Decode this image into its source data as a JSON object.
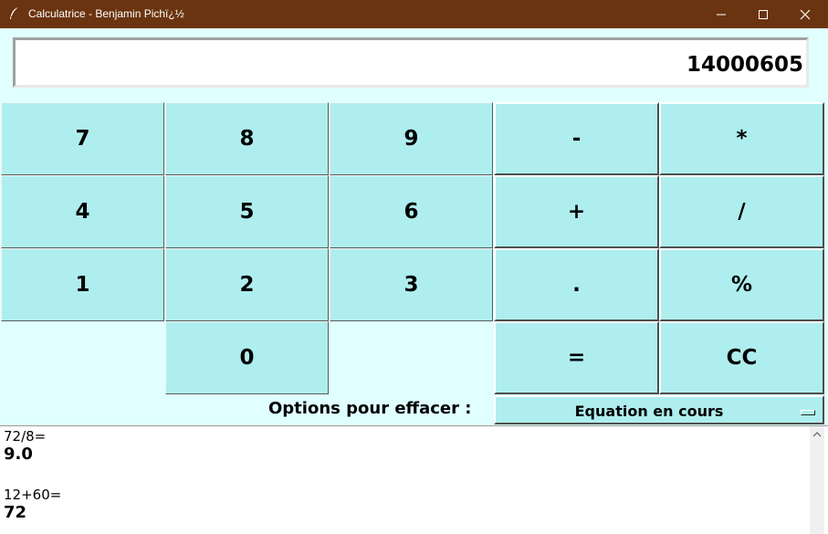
{
  "window": {
    "title": "Calculatrice - Benjamin Pichï¿½",
    "bar_color": "#6b3410",
    "icons": [
      "feather-icon",
      "minimize-icon",
      "maximize-icon",
      "close-icon"
    ]
  },
  "display": {
    "value": "14000605"
  },
  "keypad": {
    "k7": "7",
    "k8": "8",
    "k9": "9",
    "k4": "4",
    "k5": "5",
    "k6": "6",
    "k1": "1",
    "k2": "2",
    "k3": "3",
    "k0": "0",
    "minus": "-",
    "times": "*",
    "plus": "+",
    "divide": "/",
    "dot": ".",
    "percent": "%",
    "equals": "=",
    "clear": "CC"
  },
  "clear_options": {
    "label": "Options pour effacer :",
    "selected": "Equation en cours"
  },
  "history": [
    {
      "equation": "72/8=",
      "result": "9.0"
    },
    {
      "equation": "12+60=",
      "result": "72"
    }
  ],
  "colors": {
    "background": "#e0ffff",
    "button": "#afeeee"
  }
}
